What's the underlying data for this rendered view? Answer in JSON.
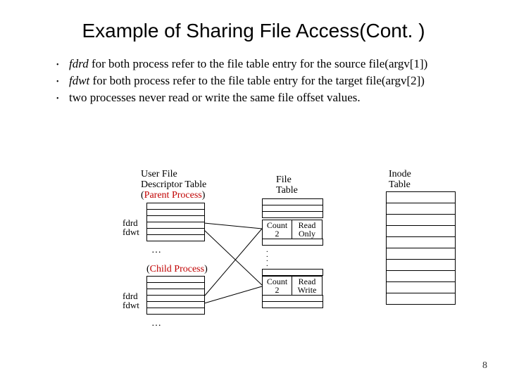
{
  "title": "Example of Sharing File Access(Cont. )",
  "bullets": [
    {
      "pre": "fdrd",
      "post": " for both process refer to the file table entry for the source file(argv[1])"
    },
    {
      "pre": "fdwt",
      "post": " for both process refer to the file table entry for the target file(argv[2])"
    },
    {
      "pre": "",
      "post": "two processes never read or write the same file offset values."
    }
  ],
  "labels": {
    "ufdt1": "User File",
    "ufdt2": "Descriptor Table",
    "ufdt3_a": "(",
    "ufdt3_b": "Parent Process",
    "ufdt3_c": ")",
    "file1": "File",
    "file2": "Table",
    "inode1": "Inode",
    "inode2": "Table",
    "fdrd": "fdrd",
    "fdwt": "fdwt",
    "child_a": "(",
    "child_b": "Child Process",
    "child_c": ")",
    "cell_count2": "Count\n2",
    "cell_readonly": "Read\nOnly",
    "cell_readwrite": "Read\nWrite",
    "ellipsis": "…"
  },
  "page": "8"
}
